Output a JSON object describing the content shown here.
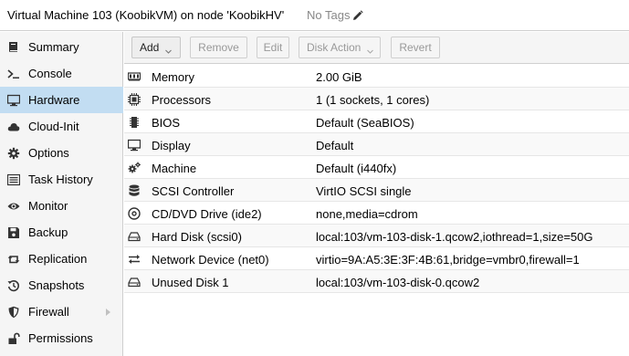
{
  "header": {
    "title": "Virtual Machine 103 (KoobikVM) on node 'KoobikHV'",
    "tags": "No Tags"
  },
  "sidebar": {
    "items": [
      {
        "label": "Summary",
        "icon": "book-icon"
      },
      {
        "label": "Console",
        "icon": "terminal-icon"
      },
      {
        "label": "Hardware",
        "icon": "desktop-icon"
      },
      {
        "label": "Cloud-Init",
        "icon": "cloud-icon"
      },
      {
        "label": "Options",
        "icon": "gear-icon"
      },
      {
        "label": "Task History",
        "icon": "list-icon"
      },
      {
        "label": "Monitor",
        "icon": "eye-icon"
      },
      {
        "label": "Backup",
        "icon": "save-icon"
      },
      {
        "label": "Replication",
        "icon": "retweet-icon"
      },
      {
        "label": "Snapshots",
        "icon": "history-icon"
      },
      {
        "label": "Firewall",
        "icon": "shield-icon"
      },
      {
        "label": "Permissions",
        "icon": "unlock-icon"
      }
    ]
  },
  "toolbar": {
    "add": "Add",
    "remove": "Remove",
    "edit": "Edit",
    "disk_action": "Disk Action",
    "revert": "Revert"
  },
  "hardware": {
    "rows": [
      {
        "name": "Memory",
        "value": "2.00 GiB",
        "icon": "memory-icon"
      },
      {
        "name": "Processors",
        "value": "1 (1 sockets, 1 cores)",
        "icon": "cpu-icon"
      },
      {
        "name": "BIOS",
        "value": "Default (SeaBIOS)",
        "icon": "microchip-icon"
      },
      {
        "name": "Display",
        "value": "Default",
        "icon": "display-icon"
      },
      {
        "name": "Machine",
        "value": "Default (i440fx)",
        "icon": "cogs-icon"
      },
      {
        "name": "SCSI Controller",
        "value": "VirtIO SCSI single",
        "icon": "database-icon"
      },
      {
        "name": "CD/DVD Drive (ide2)",
        "value": "none,media=cdrom",
        "icon": "cdrom-icon"
      },
      {
        "name": "Hard Disk (scsi0)",
        "value": "local:103/vm-103-disk-1.qcow2,iothread=1,size=50G",
        "icon": "hdd-icon"
      },
      {
        "name": "Network Device (net0)",
        "value": "virtio=9A:A5:3E:3F:4B:61,bridge=vmbr0,firewall=1",
        "icon": "exchange-icon"
      },
      {
        "name": "Unused Disk 1",
        "value": "local:103/vm-103-disk-0.qcow2",
        "icon": "hdd-icon"
      }
    ]
  },
  "colors": {
    "active_nav": "#c2ddf2",
    "sidebar_bg": "#f5f5f5",
    "toolbar_bg": "#f5f5f5"
  }
}
